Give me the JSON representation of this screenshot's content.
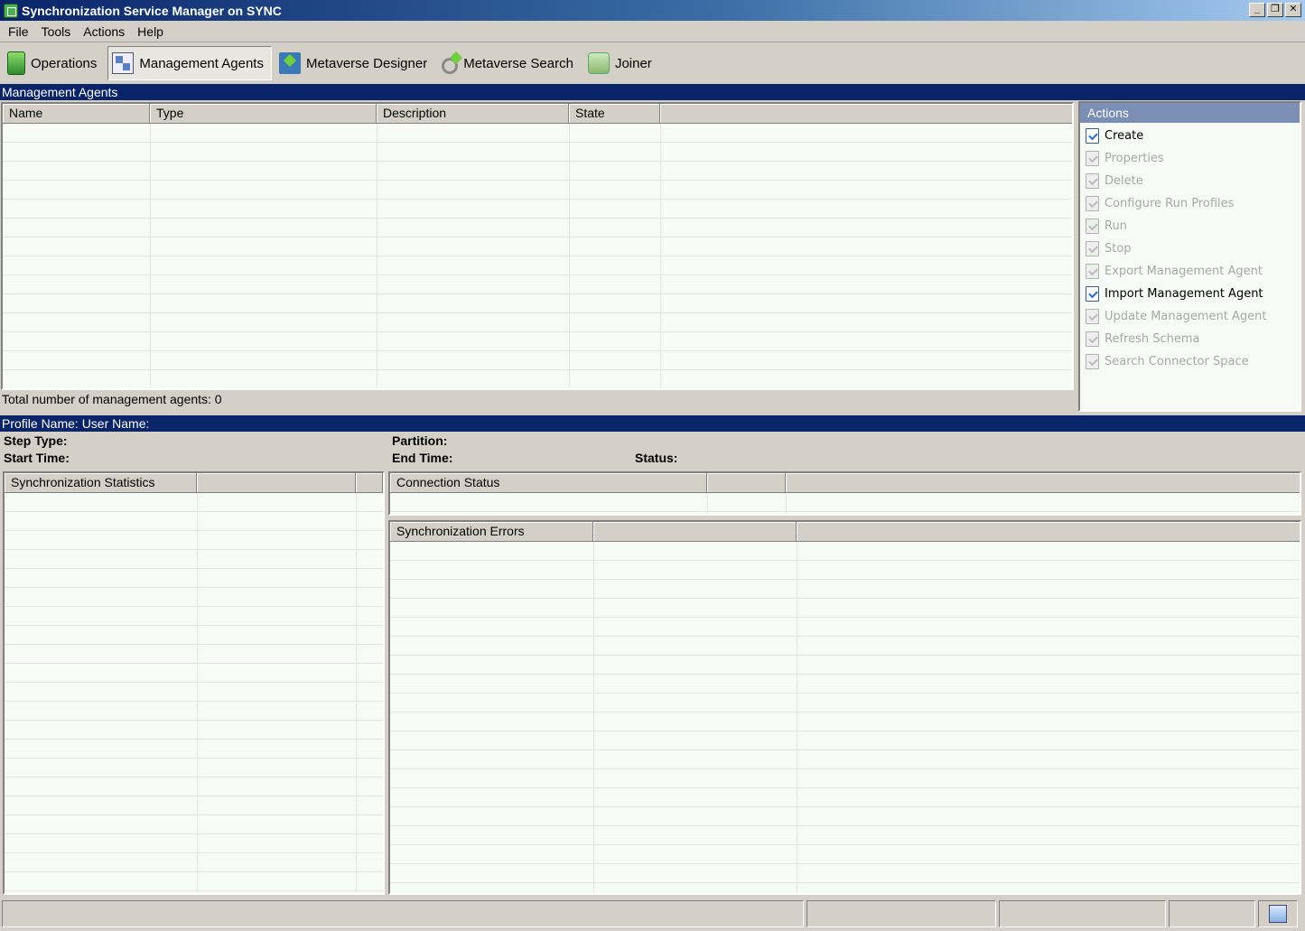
{
  "window": {
    "title": "Synchronization Service Manager on SYNC",
    "minimize": "_",
    "restore": "❐",
    "close": "✕"
  },
  "menu": [
    "File",
    "Tools",
    "Actions",
    "Help"
  ],
  "toolbar": [
    {
      "label": "Operations",
      "icon": "operations-icon"
    },
    {
      "label": "Management Agents",
      "icon": "management-agents-icon",
      "active": true
    },
    {
      "label": "Metaverse Designer",
      "icon": "metaverse-designer-icon"
    },
    {
      "label": "Metaverse Search",
      "icon": "metaverse-search-icon"
    },
    {
      "label": "Joiner",
      "icon": "joiner-icon"
    }
  ],
  "management_agents": {
    "header": "Management Agents",
    "columns": [
      "Name",
      "Type",
      "Description",
      "State",
      ""
    ],
    "rows": [],
    "total": "Total number of management agents: 0"
  },
  "actions": {
    "title": "Actions",
    "items": [
      {
        "label": "Create",
        "enabled": true
      },
      {
        "label": "Properties",
        "enabled": false
      },
      {
        "label": "Delete",
        "enabled": false
      },
      {
        "label": "Configure Run Profiles",
        "enabled": false
      },
      {
        "label": "Run",
        "enabled": false
      },
      {
        "label": "Stop",
        "enabled": false
      },
      {
        "label": "Export Management Agent",
        "enabled": false
      },
      {
        "label": "Import Management Agent",
        "enabled": true
      },
      {
        "label": "Update Management Agent",
        "enabled": false
      },
      {
        "label": "Refresh Schema",
        "enabled": false
      },
      {
        "label": "Search Connector Space",
        "enabled": false
      }
    ]
  },
  "profile": {
    "header": "Profile Name:   User Name:",
    "step_type": "Step Type:",
    "start_time": "Start Time:",
    "partition": "Partition:",
    "end_time": "End Time:",
    "status": "Status:"
  },
  "sync_stats": {
    "header": "Synchronization Statistics"
  },
  "connection_status": {
    "header": "Connection Status"
  },
  "sync_errors": {
    "header": "Synchronization Errors"
  },
  "colors": {
    "title_bar": "#0a246a",
    "section_bar": "#0a246a",
    "grid_bg": "#f7fbf5",
    "actions_header": "#7b8fb4"
  }
}
